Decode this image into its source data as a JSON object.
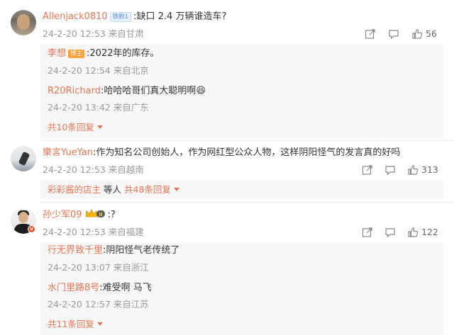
{
  "comments": [
    {
      "user": "Allenjack0810",
      "badge": "铁粉1",
      "text": ":缺口 2.4 万辆谁造车?",
      "meta": "24-2-20 12:53 来自甘肃",
      "likes": "56",
      "replies": [
        {
          "user": "李想",
          "badge": "博主",
          "text": ":2022年的库存。",
          "meta": "24-2-20 12:54 来自北京"
        },
        {
          "user": "R20Richard",
          "text": ":哈哈哈哥们真大聪明啊",
          "emoji": "😆",
          "meta": "24-2-20 13:42 来自广东"
        }
      ],
      "more_replies": "共10条回复"
    },
    {
      "user": "樂言YueYan",
      "text": ":作为知名公司创始人，作为网红型公众人物，这样阴阳怪气的发言真的好吗",
      "meta": "24-2-20 12:53 来自越南",
      "likes": "313",
      "reply_summary_users": "彩彩酱的店主",
      "reply_summary_mid": "等人",
      "more_replies": "共48条回复"
    },
    {
      "user": "孙少军09",
      "level": "II",
      "text": ":?",
      "meta": "24-2-20 12:53 来自福建",
      "likes": "122",
      "replies": [
        {
          "user": "行无界致千里",
          "text": ":阴阳怪气老传统了",
          "meta": "24-2-20 13:07 来自浙江"
        },
        {
          "user": "水门里路8号",
          "text": ":难受啊 马飞",
          "meta": "24-2-20 12:57 来自江苏"
        }
      ],
      "more_replies": "共11条回复"
    }
  ],
  "icons": [
    "share-icon",
    "comment-icon",
    "like-icon",
    "chevron-down-icon",
    "verified-icon",
    "crown-icon"
  ],
  "colors": {
    "name": "#eb7350",
    "meta": "#999999",
    "reply_bg": "#f7f7f7",
    "verified": "#f0532a"
  }
}
